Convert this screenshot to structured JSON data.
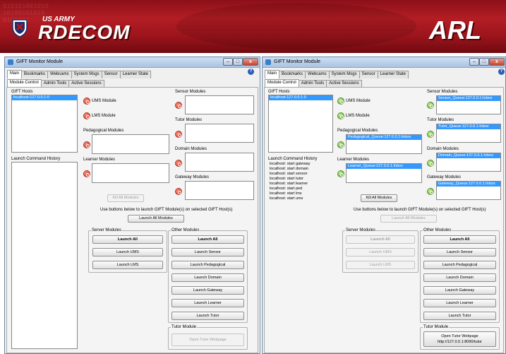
{
  "banner": {
    "army": "US ARMY",
    "rdecom": "RDECOM",
    "arl": "ARL",
    "binary": "010101001010\n10100101010\n0101001"
  },
  "colors": {
    "banner_red": "#b31d24",
    "select_blue": "#3399ff",
    "module_down": "#d4331b",
    "module_up": "#52a81e"
  },
  "left": {
    "title": "GIFT Monitor Module",
    "tabs": [
      "Main",
      "Bookmarks",
      "Webcams",
      "System Msgs",
      "Sensor",
      "Learner State"
    ],
    "subtabs": [
      "Module Control",
      "Admin Tools",
      "Active Sessions"
    ],
    "gift_hosts_label": "GIFT Hosts",
    "host": "localhost:127.0.0.1:0",
    "ums": "UMS Module",
    "lms": "LMS Module",
    "ped_label": "Pedagogical Modules",
    "learner_label": "Learner Modules",
    "sensor_label": "Sensor Modules",
    "tutor_label": "Tutor Modules",
    "domain_label": "Domain Modules",
    "gateway_label": "Gateway Modules",
    "history_label": "Launch Command History",
    "kill_all": "Kill All Modules",
    "instruction": "Use buttons below to launch GIFT Module(s) on selected GIFT Host(s)",
    "launch_all_modules": "Launch All Modules",
    "server_modules": "Server Modules",
    "other_modules": "Other Modules",
    "server_buttons": [
      "Launch All",
      "Launch UMS",
      "Launch LMS"
    ],
    "other_buttons": [
      "Launch All",
      "Launch Sensor",
      "Launch Pedagogical",
      "Launch Domain",
      "Launch Gateway",
      "Launch Learner",
      "Launch Tutor"
    ],
    "tutor_module": "Tutor Module",
    "tutor_webpage": "Open Tutor Webpage"
  },
  "right": {
    "title": "GIFT Monitor Module",
    "tabs": [
      "Main",
      "Bookmarks",
      "Webcams",
      "System Msgs",
      "Sensor",
      "Learner State"
    ],
    "subtabs": [
      "Module Control",
      "Admin Tools",
      "Active Sessions"
    ],
    "gift_hosts_label": "GIFT Hosts",
    "host": "localhost:127.0.0.1:0",
    "ums": "UMS Module",
    "lms": "LMS Module",
    "ped_label": "Pedagogical Modules",
    "ped_queue": "Pedagogical_Queue:127.0.0.1:Inbox",
    "learner_label": "Learner Modules",
    "learner_queue": "Learner_Queue:127.0.0.1:Inbox",
    "sensor_label": "Sensor Modules",
    "sensor_queue": "Sensor_Queue:127.0.0.1:Inbox",
    "tutor_label": "Tutor Modules",
    "tutor_queue": "Tutor_Queue:127.0.0.1:Inbox",
    "domain_label": "Domain Modules",
    "domain_queue": "Domain_Queue:127.0.0.1:Inbox",
    "gateway_label": "Gateway Modules",
    "gateway_queue": "Gateway_Queue:127.0.0.1:Inbox",
    "history_label": "Launch Command History",
    "history": [
      "localhost: start gateway",
      "localhost: start domain",
      "localhost: start sensor",
      "localhost: start tutor",
      "localhost: start learner",
      "localhost: start ped",
      "localhost: start lms",
      "localhost: start ums"
    ],
    "kill_all": "Kill All Modules",
    "instruction": "Use buttons below to launch GIFT Module(s) on selected GIFT Host(s)",
    "launch_all_modules": "Launch All Modules",
    "server_modules": "Server Modules",
    "other_modules": "Other Modules",
    "server_buttons": [
      "Launch All",
      "Launch UMS",
      "Launch LMS"
    ],
    "other_buttons": [
      "Launch All",
      "Launch Sensor",
      "Launch Pedagogical",
      "Launch Domain",
      "Launch Gateway",
      "Launch Learner",
      "Launch Tutor"
    ],
    "tutor_module": "Tutor Module",
    "tutor_webpage": "Open Tutor Webpage",
    "tutor_url": "http://127.0.0.1:8090/tutor"
  }
}
